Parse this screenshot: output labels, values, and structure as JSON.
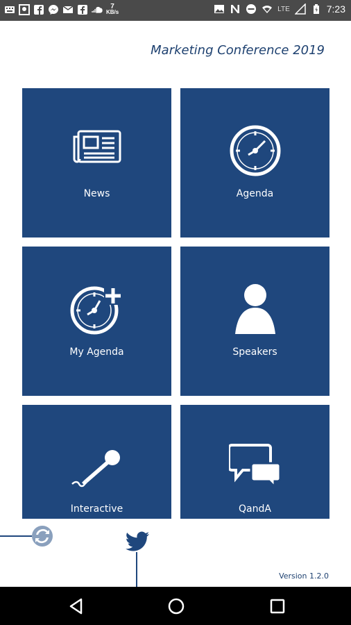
{
  "status_bar": {
    "left_icons": [
      "keyboard-icon",
      "gallery-icon",
      "facebook-icon",
      "messenger-icon",
      "gmail-icon",
      "facebook-pages-icon",
      "soundcloud-icon"
    ],
    "data_speed_value": "7",
    "data_speed_unit": "KB/s",
    "right_icons": [
      "image-icon",
      "n-app-icon",
      "do-not-disturb-icon",
      "wifi-icon"
    ],
    "network": "LTE",
    "time": "7:23"
  },
  "header": {
    "title": "Marketing Conference 2019"
  },
  "tiles": [
    {
      "label": "News",
      "icon": "newspaper-icon"
    },
    {
      "label": "Agenda",
      "icon": "clock-icon"
    },
    {
      "label": "My Agenda",
      "icon": "clock-plus-icon"
    },
    {
      "label": "Speakers",
      "icon": "person-icon"
    },
    {
      "label": "Interactive",
      "icon": "microphone-icon"
    },
    {
      "label": "QandA",
      "icon": "chat-bubbles-icon"
    }
  ],
  "footer": {
    "version": "Version 1.2.0"
  },
  "colors": {
    "tile": "#1f477d",
    "title": "#1e4170",
    "status_bar": "#4a4a4a"
  }
}
